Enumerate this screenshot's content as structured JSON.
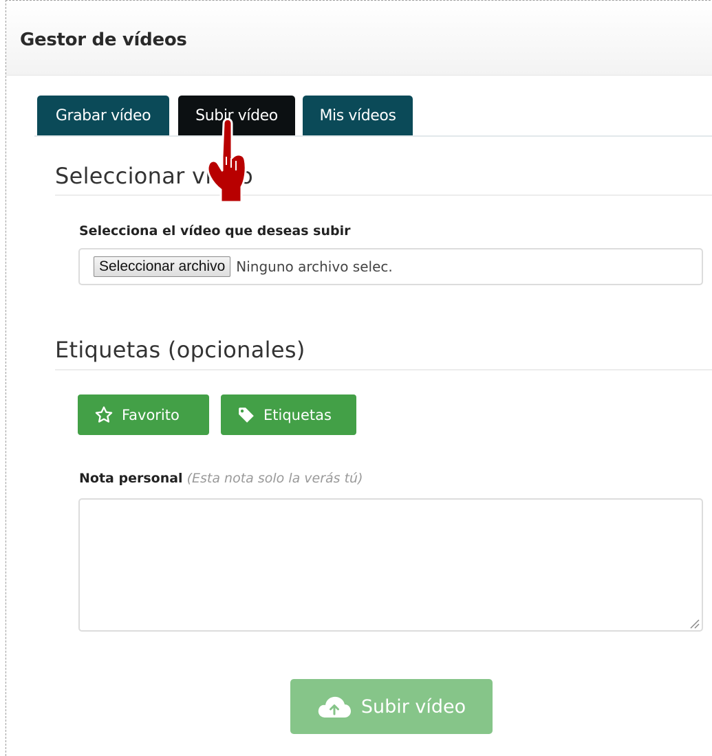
{
  "header": {
    "title": "Gestor de vídeos"
  },
  "tabs": [
    {
      "label": "Grabar vídeo",
      "active": false
    },
    {
      "label": "Subir vídeo",
      "active": true
    },
    {
      "label": "Mis vídeos",
      "active": false
    }
  ],
  "upload_section": {
    "title": "Seleccionar vídeo",
    "file_label": "Selecciona el vídeo que deseas subir",
    "file_button": "Seleccionar archivo",
    "file_status": "Ninguno archivo selec."
  },
  "tags_section": {
    "title": "Etiquetas (opcionales)",
    "favorite_button": "Favorito",
    "favorite_icon": "star-outline-icon",
    "tags_button": "Etiquetas",
    "tags_icon": "tag-icon"
  },
  "note": {
    "label": "Nota personal",
    "hint": "(Esta nota solo la verás tú)",
    "value": ""
  },
  "submit": {
    "label": "Subir vídeo",
    "icon": "cloud-upload-icon"
  },
  "colors": {
    "tab": "#0b4a58",
    "tab_active": "#0c1012",
    "button_green": "#43a047",
    "button_green_disabled": "#86c589",
    "pointer": "#b00000"
  }
}
